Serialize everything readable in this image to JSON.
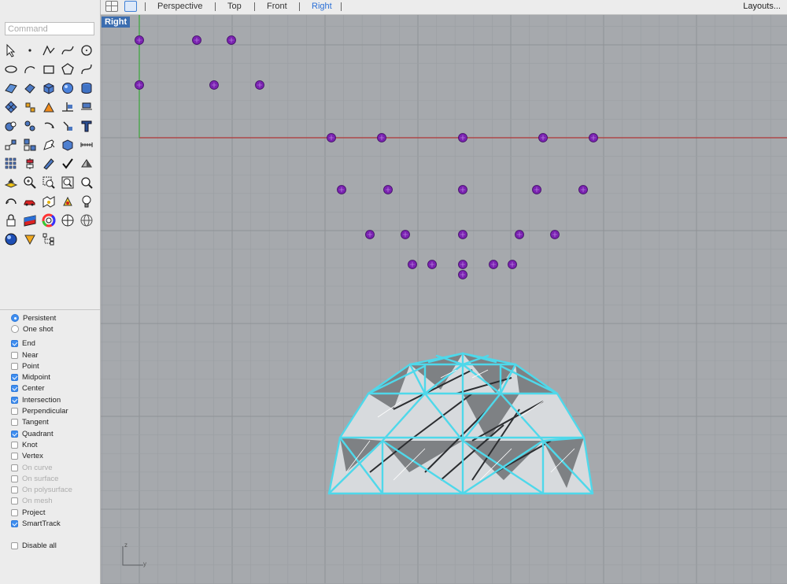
{
  "topbar": {
    "tabs": [
      {
        "label": "Perspective",
        "active": false
      },
      {
        "label": "Top",
        "active": false
      },
      {
        "label": "Front",
        "active": false
      },
      {
        "label": "Right",
        "active": true
      }
    ],
    "layouts_label": "Layouts..."
  },
  "command": {
    "placeholder": "Command",
    "value": ""
  },
  "toolbar": {
    "tools": [
      "select-arrow-icon",
      "point-icon",
      "polyline-icon",
      "curve-icon",
      "circle-icon",
      "ellipse-icon",
      "arc-icon",
      "rectangle-icon",
      "polygon-icon",
      "freeform-curve-icon",
      "surface-from-points-icon",
      "extrude-icon",
      "box-icon",
      "sphere-icon",
      "cylinder-icon",
      "mesh-icon",
      "explode-icon",
      "fillet-icon",
      "trim-icon",
      "split-icon",
      "boolean-icon",
      "group-icon",
      "rotate-icon",
      "move-3d-icon",
      "text-icon",
      "transform-icon",
      "array-icon",
      "edit-icon",
      "box-edit-icon",
      "dimension-icon",
      "grid-array-icon",
      "dimension-vertical-icon",
      "pencil-edit-icon",
      "check-icon",
      "shade-icon",
      "layer-icon",
      "zoom-in-icon",
      "zoom-window-icon",
      "zoom-extents-icon",
      "zoom-icon",
      "render-icon",
      "car-icon",
      "map-icon",
      "light-icon",
      "lightbulb-icon",
      "lock-icon",
      "material-icon",
      "color-wheel-icon",
      "ghosted-icon",
      "wireframe-icon",
      "sphere-render-icon",
      "wedge-icon",
      "hierarchy-icon"
    ]
  },
  "osnap": {
    "mode": [
      {
        "label": "Persistent",
        "checked": true
      },
      {
        "label": "One shot",
        "checked": false
      }
    ],
    "snaps": [
      {
        "label": "End",
        "checked": true,
        "disabled": false
      },
      {
        "label": "Near",
        "checked": false,
        "disabled": false
      },
      {
        "label": "Point",
        "checked": false,
        "disabled": false
      },
      {
        "label": "Midpoint",
        "checked": true,
        "disabled": false
      },
      {
        "label": "Center",
        "checked": true,
        "disabled": false
      },
      {
        "label": "Intersection",
        "checked": true,
        "disabled": false
      },
      {
        "label": "Perpendicular",
        "checked": false,
        "disabled": false
      },
      {
        "label": "Tangent",
        "checked": false,
        "disabled": false
      },
      {
        "label": "Quadrant",
        "checked": true,
        "disabled": false
      },
      {
        "label": "Knot",
        "checked": false,
        "disabled": false
      },
      {
        "label": "Vertex",
        "checked": false,
        "disabled": false
      },
      {
        "label": "On curve",
        "checked": false,
        "disabled": true
      },
      {
        "label": "On surface",
        "checked": false,
        "disabled": true
      },
      {
        "label": "On polysurface",
        "checked": false,
        "disabled": true
      },
      {
        "label": "On mesh",
        "checked": false,
        "disabled": true
      },
      {
        "label": "Project",
        "checked": false,
        "disabled": false
      },
      {
        "label": "SmartTrack",
        "checked": true,
        "disabled": false
      }
    ],
    "disable_all": {
      "label": "Disable all",
      "checked": false
    }
  },
  "viewport": {
    "title": "Right",
    "axis_z_label": "z",
    "axis_y_label": "y",
    "colors": {
      "background": "#a6a9ad",
      "grid_minor": "#9c9fa3",
      "grid_major": "#8f9296",
      "x_axis": "#b13636",
      "y_axis": "#3aa63a",
      "control_point": "#7a22b0",
      "dome_edges": "#4fd8ea"
    }
  }
}
